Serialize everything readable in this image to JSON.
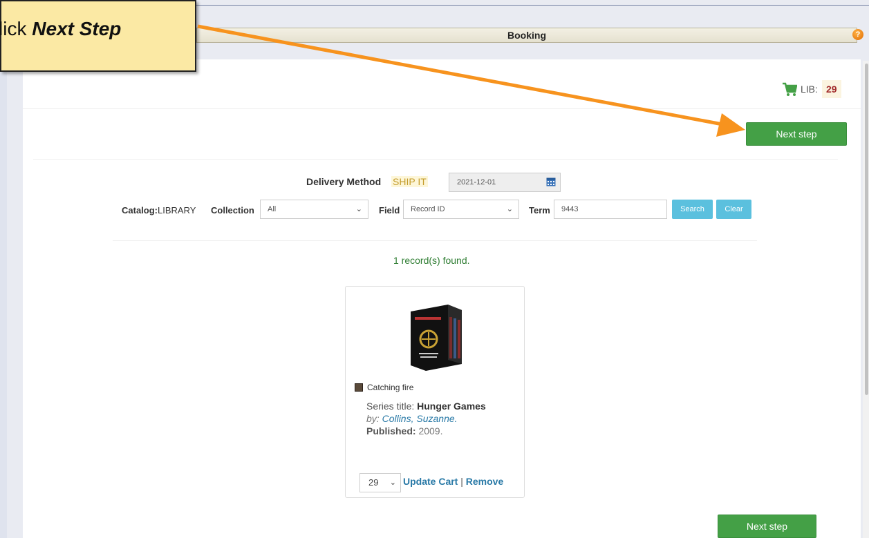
{
  "header": {
    "title": "Booking",
    "help_icon": "help-icon",
    "help_glyph": "?"
  },
  "callout": {
    "prefix": "lick ",
    "emphasis": "Next Step"
  },
  "cart": {
    "label": "LIB:",
    "count": "29",
    "icon": "cart-icon",
    "color": "#44a046"
  },
  "actions": {
    "next_step_label": "Next step"
  },
  "delivery": {
    "label": "Delivery Method",
    "method": "SHIP IT",
    "date": "2021-12-01",
    "calendar_icon": "calendar-icon"
  },
  "search": {
    "catalog_label": "Catalog:",
    "catalog_value": "LIBRARY",
    "collection_label": "Collection",
    "collection_value": "All",
    "field_label": "Field",
    "field_value": "Record ID",
    "term_label": "Term",
    "term_value": "9443",
    "search_button": "Search",
    "clear_button": "Clear"
  },
  "results": {
    "found_text": "1 record(s) found.",
    "item": {
      "title": "Catching fire",
      "series_label": "Series title:",
      "series_value": "Hunger Games",
      "author_prefix": "by:",
      "author": "Collins, Suzanne.",
      "published_label": "Published:",
      "published_value": "2009.",
      "quantity": "29",
      "update_link": "Update Cart",
      "separator": "|",
      "remove_link": "Remove"
    }
  },
  "colors": {
    "accent_green": "#44a046",
    "accent_blue": "#5bc0de",
    "arrow_orange": "#f7931e",
    "callout_bg": "#fbe9a4"
  }
}
